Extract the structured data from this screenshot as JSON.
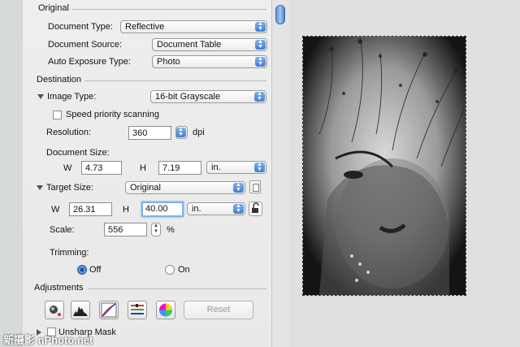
{
  "original": {
    "section_title": "Original",
    "document_type_label": "Document Type:",
    "document_type_value": "Reflective",
    "document_source_label": "Document Source:",
    "document_source_value": "Document Table",
    "auto_exposure_label": "Auto Exposure Type:",
    "auto_exposure_value": "Photo"
  },
  "destination": {
    "section_title": "Destination",
    "image_type_label": "Image Type:",
    "image_type_value": "16-bit Grayscale",
    "speed_priority_label": "Speed priority scanning",
    "resolution_label": "Resolution:",
    "resolution_value": "360",
    "resolution_unit": "dpi",
    "document_size_label": "Document Size:",
    "doc_w_label": "W",
    "doc_w_value": "4.73",
    "doc_h_label": "H",
    "doc_h_value": "7.19",
    "doc_unit": "in.",
    "target_size_label": "Target Size:",
    "target_size_value": "Original",
    "target_w_label": "W",
    "target_w_value": "26.31",
    "target_h_label": "H",
    "target_h_value": "40.00",
    "target_unit": "in.",
    "scale_label": "Scale:",
    "scale_value": "556",
    "scale_unit": "%",
    "trimming_label": "Trimming:",
    "trim_off_label": "Off",
    "trim_on_label": "On"
  },
  "adjustments": {
    "section_title": "Adjustments",
    "reset_label": "Reset",
    "unsharp_mask_label": "Unsharp Mask"
  },
  "watermark": "新摄影 nPhoto.net",
  "colors": {
    "accent": "#3f7fd0",
    "panel_bg": "#eeeeee"
  }
}
